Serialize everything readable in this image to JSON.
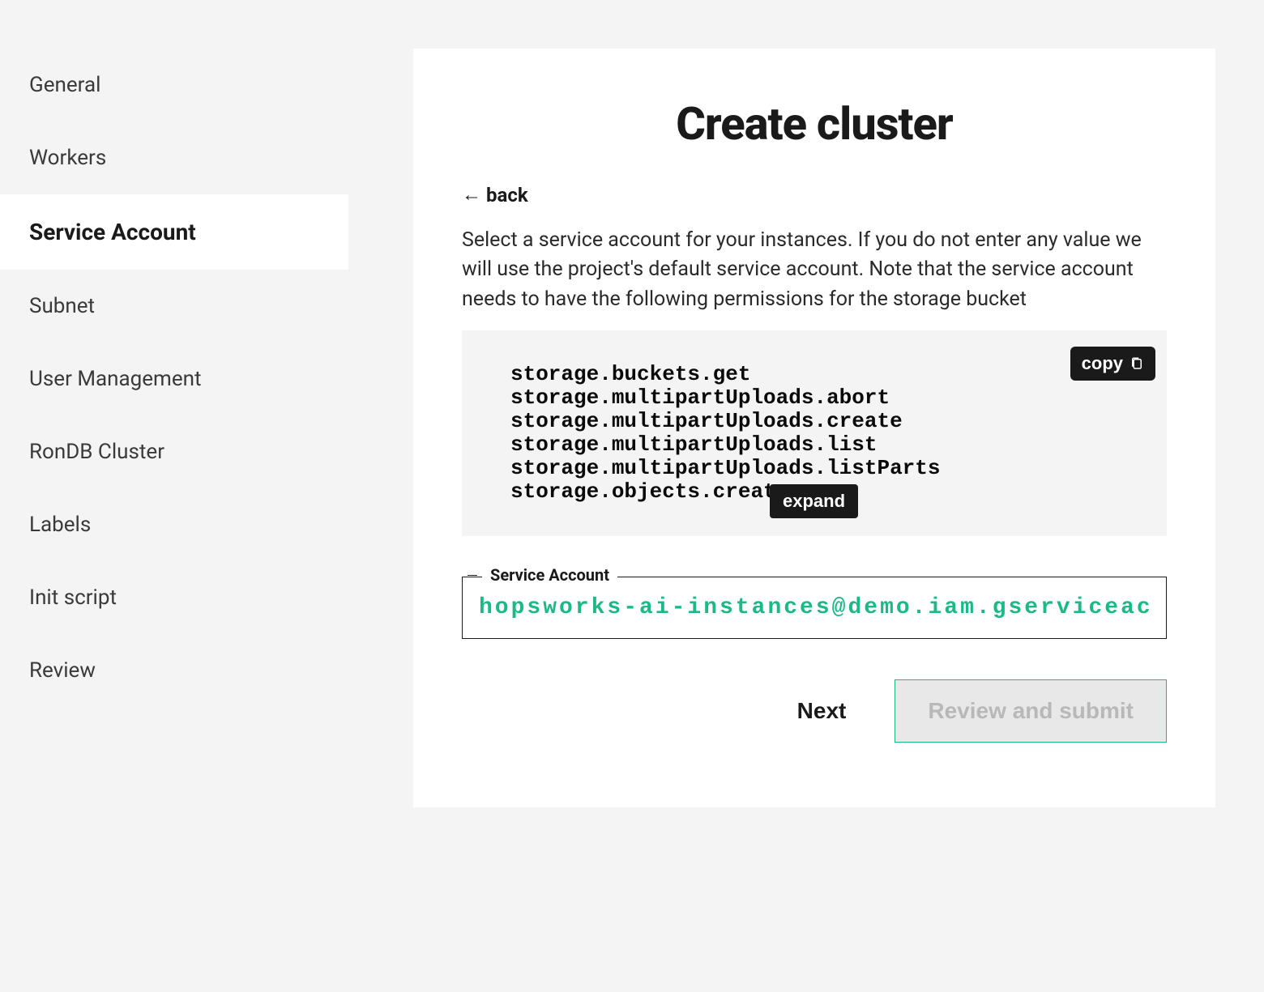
{
  "sidebar": {
    "items": [
      {
        "label": "General"
      },
      {
        "label": "Workers"
      },
      {
        "label": "Service Account"
      },
      {
        "label": "Subnet"
      },
      {
        "label": "User Management"
      },
      {
        "label": "RonDB Cluster"
      },
      {
        "label": "Labels"
      },
      {
        "label": "Init script"
      },
      {
        "label": "Review"
      }
    ],
    "active_index": 2
  },
  "main": {
    "title": "Create cluster",
    "back_label": "back",
    "description": "Select a service account for your instances. If you do not enter any value we will use the project's default service account. Note that the service account needs to have the following permissions for the storage bucket",
    "code": {
      "copy_label": "copy",
      "expand_label": "expand",
      "lines": [
        "storage.buckets.get",
        "storage.multipartUploads.abort",
        "storage.multipartUploads.create",
        "storage.multipartUploads.list",
        "storage.multipartUploads.listParts",
        "storage.objects.create"
      ]
    },
    "field": {
      "legend": "Service Account",
      "value": "hopsworks-ai-instances@demo.iam.gserviceaccount.com"
    },
    "actions": {
      "next_label": "Next",
      "review_label": "Review and submit"
    }
  }
}
